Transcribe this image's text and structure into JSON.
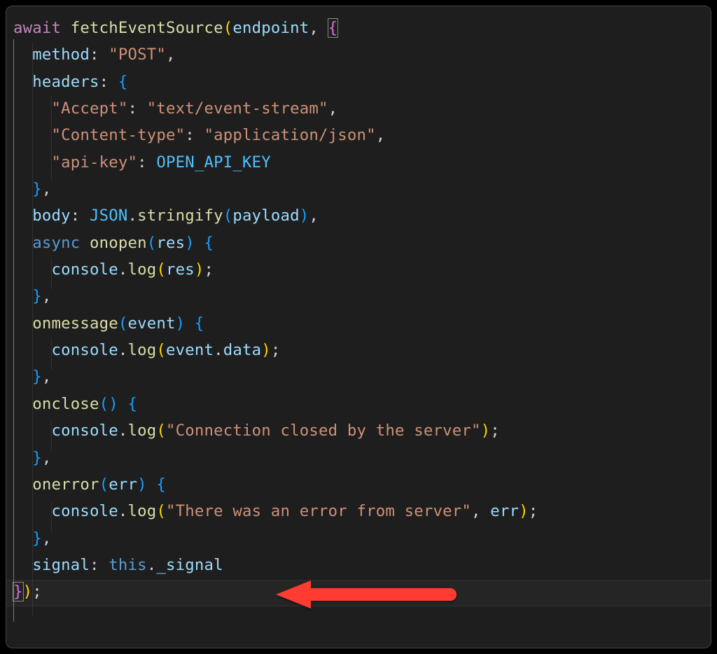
{
  "code": {
    "l1_await": "await",
    "l1_fn": "fetchEventSource",
    "l1_arg": "endpoint",
    "l2_prop": "method",
    "l2_val": "\"POST\"",
    "l3_prop": "headers",
    "l4_key": "\"Accept\"",
    "l4_val": "\"text/event-stream\"",
    "l5_key": "\"Content-type\"",
    "l5_val": "\"application/json\"",
    "l6_key": "\"api-key\"",
    "l6_val": "OPEN_API_KEY",
    "l8_prop": "body",
    "l8_json": "JSON",
    "l8_stringify": "stringify",
    "l8_payload": "payload",
    "l9_async": "async",
    "l9_onopen": "onopen",
    "l9_res": "res",
    "l10_console": "console",
    "l10_log": "log",
    "l10_res": "res",
    "l12_onmessage": "onmessage",
    "l12_event": "event",
    "l13_console": "console",
    "l13_log": "log",
    "l13_event": "event",
    "l13_data": "data",
    "l15_onclose": "onclose",
    "l16_console": "console",
    "l16_log": "log",
    "l16_msg": "\"Connection closed by the server\"",
    "l18_onerror": "onerror",
    "l18_err": "err",
    "l19_console": "console",
    "l19_log": "log",
    "l19_msg": "\"There was an error from server\"",
    "l19_err": "err",
    "l21_prop": "signal",
    "l21_this": "this",
    "l21_signal": "_signal"
  },
  "annotation": {
    "arrow_color": "#ff3b30"
  }
}
